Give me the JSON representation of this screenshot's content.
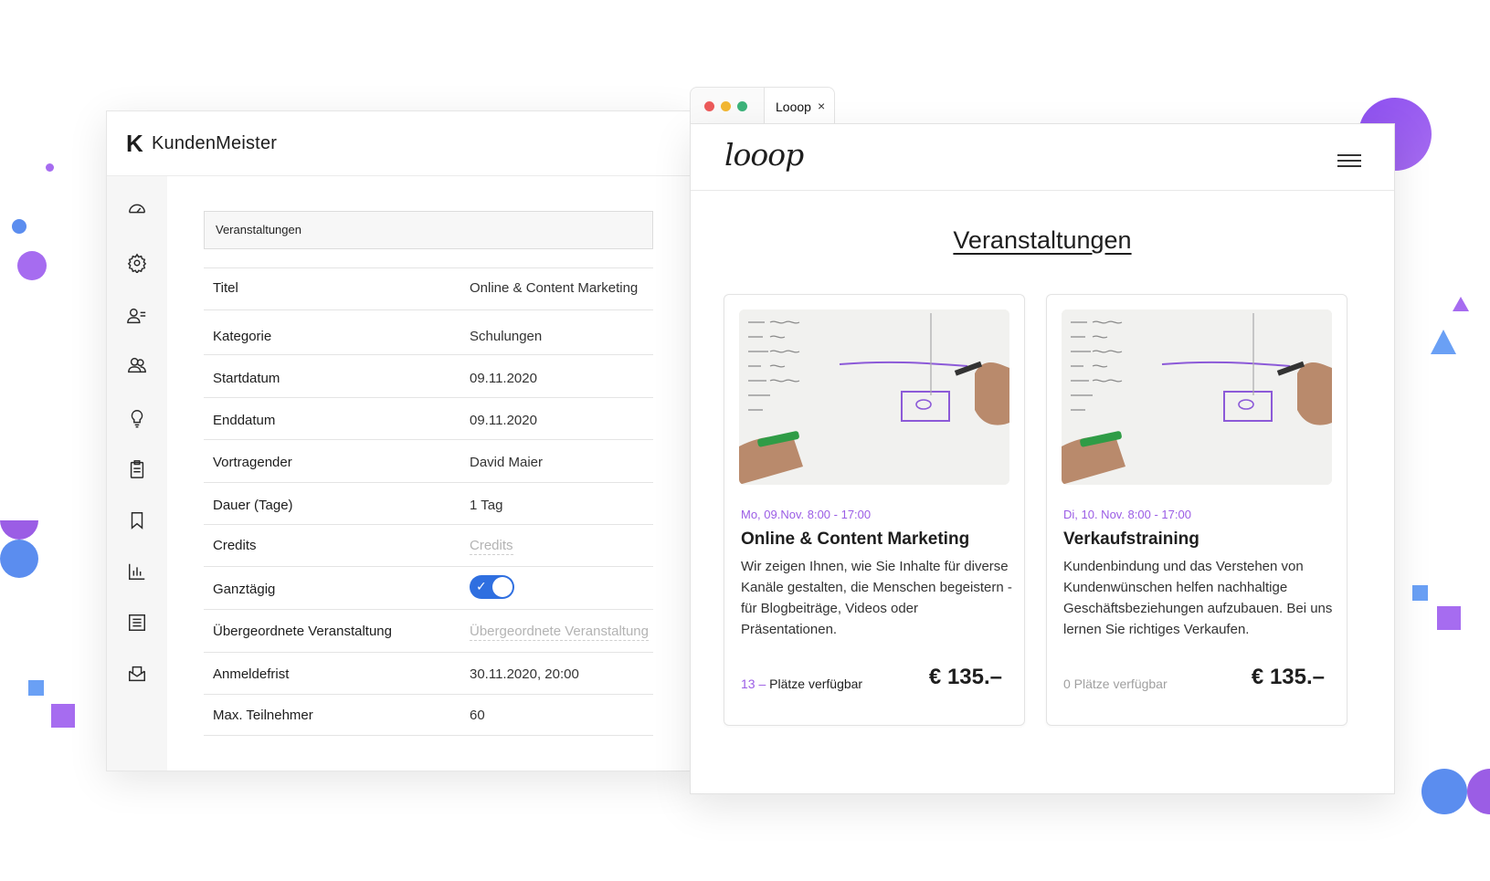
{
  "crm": {
    "logo_mark": "K",
    "app_name": "KundenMeister",
    "section_field": "Veranstaltungen",
    "sidebar_icons": [
      "dashboard-icon",
      "settings-icon",
      "contacts-list-icon",
      "users-icon",
      "lightbulb-icon",
      "clipboard-icon",
      "bookmark-icon",
      "bar-chart-icon",
      "list-doc-icon",
      "mail-icon"
    ],
    "rows": [
      {
        "label": "Titel",
        "value": "Online & Content Marketing"
      },
      {
        "label": "Kategorie",
        "value": "Schulungen"
      },
      {
        "label": "Startdatum",
        "value": "09.11.2020"
      },
      {
        "label": "Enddatum",
        "value": "09.11.2020"
      },
      {
        "label": "Vortragender",
        "value": "David Maier"
      },
      {
        "label": "Dauer (Tage)",
        "value": "1 Tag"
      },
      {
        "label": "Credits",
        "placeholder": "Credits"
      },
      {
        "label": "Ganztägig",
        "toggle_on": true
      },
      {
        "label": "Übergeordnete Veranstaltung",
        "placeholder": "Übergeordnete Veranstaltung"
      },
      {
        "label": "Anmeldefrist",
        "value": "30.11.2020, 20:00"
      },
      {
        "label": "Max. Teilnehmer",
        "value": "60"
      }
    ]
  },
  "browser": {
    "tab_title": "Looop",
    "tab_close": "×",
    "traffic_lights": [
      "#ec5b5b",
      "#f2b733",
      "#3cb37a"
    ],
    "site_logo": "looop",
    "page_title": "Veranstaltungen",
    "cards": [
      {
        "date": "Mo, 09.Nov. 8:00 - 17:00",
        "title": "Online & Content Marketing",
        "description": "Wir zeigen Ihnen, wie Sie Inhalte für diverse Kanäle gestalten, die Menschen begeistern - für Blogbeiträge, Videos oder Präsentationen.",
        "seats_count": "13 –",
        "seats_label": "Plätze verfügbar",
        "price": "€ 135.–"
      },
      {
        "date": "Di, 10. Nov. 8:00 - 17:00",
        "title": "Verkaufstraining",
        "description": "Kundenbindung und das Verstehen von Kundenwünschen helfen nachhaltige Geschäftsbeziehungen aufzubauen. Bei uns lernen Sie richtiges Verkaufen.",
        "seats_label": "0 Plätze verfügbar",
        "price": "€ 135.–"
      }
    ]
  },
  "colors": {
    "accent_purple": "#9b5de5",
    "accent_blue": "#5b8def",
    "toggle_blue": "#2f6fe0"
  }
}
